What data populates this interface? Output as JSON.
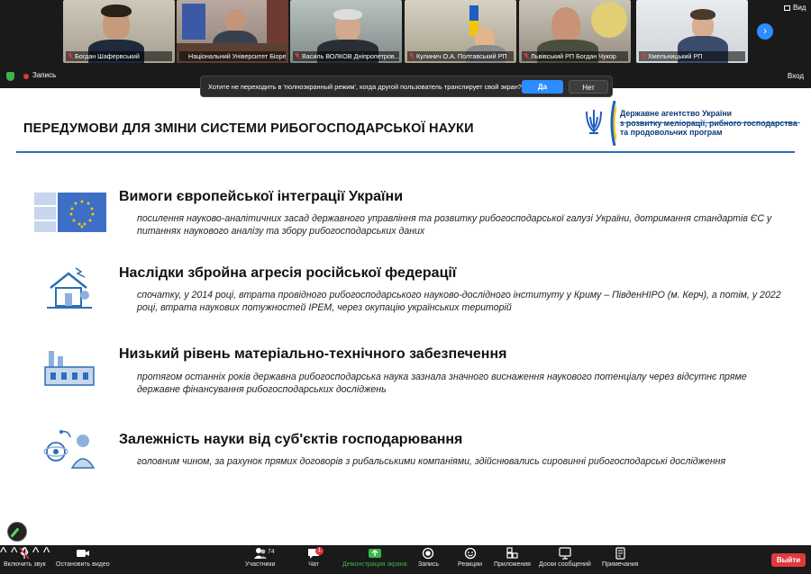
{
  "video_strip": {
    "participants": [
      {
        "name": "Богдан Шафервський",
        "muted": true
      },
      {
        "name": "Національний Університет Біоресу...",
        "muted": false
      },
      {
        "name": "Василь ВОЛКОВ Дніпропетров...",
        "muted": true
      },
      {
        "name": "Кулинич О.А. Полтавський РП",
        "muted": true
      },
      {
        "name": "Львівський РП Богдан Чукор",
        "muted": true
      },
      {
        "name": "Хмельницький РП",
        "muted": true
      }
    ],
    "view_label": "Вид",
    "next_arrow": "›"
  },
  "recording": {
    "label": "Запись",
    "exit_fullscreen": "Вход"
  },
  "fullscreen_prompt": {
    "message": "Хотите не переходить в 'полноэкранный режим', когда другой пользователь транслирует свой экран?",
    "yes": "Да",
    "no": "Нет"
  },
  "slide": {
    "title": "ПЕРЕДУМОВИ ДЛЯ ЗМІНИ СИСТЕМИ РИБОГОСПОДАРСЬКОЇ НАУКИ",
    "agency": {
      "line1": "Державне агентство України",
      "line2": "з розвитку меліорації, рибного господарства",
      "line3": "та продовольчих програм"
    },
    "items": [
      {
        "heading": "Вимоги європейської інтеграції України",
        "text": "посилення науково-аналітичних засад державного управління та розвитку рибогосподарської галузі України, дотримання стандартів ЄС у питаннях наукового аналізу та збору рибогосподарських даних",
        "icon": "eu-flag-icon"
      },
      {
        "heading": "Наслідки збройна агресія російської федерації",
        "text": "спочатку, у 2014 році, втрата провідного рибогосподарського науково-дослідного інституту у Криму – ПівденНІРО (м. Керч), а потім, у 2022 році, втрата наукових потужностей ІРЕМ, через окупацію українських територій",
        "icon": "destroyed-house-icon"
      },
      {
        "heading": "Низький рівень матеріально-технічного забезпечення",
        "text": "протягом останніх років державна рибогосподарська наука зазнала значного виснаження наукового потенціалу через відсутнє пряме державне фінансування рибогосподарських досліджень",
        "icon": "factory-icon"
      },
      {
        "heading": "Залежність науки від суб'єктів господарювання",
        "text": "головним чином, за рахунок прямих договорів з рибальськими компаніями, здійснювались сировинні рибогосподарські дослідження",
        "icon": "science-network-icon"
      }
    ]
  },
  "toolbar": {
    "unmute": "Включить звук",
    "stop_video": "Остановить видео",
    "participants": "Участники",
    "participants_count": "74",
    "chat": "Чат",
    "chat_badge": "1",
    "share_screen": "Демонстрация экрана",
    "record": "Запись",
    "reactions": "Реакции",
    "apps": "Приложения",
    "whiteboards": "Доски сообщений",
    "notes": "Примечания",
    "leave": "Выйти"
  },
  "colors": {
    "accent_blue": "#2d8cff",
    "leave_red": "#e0393e",
    "share_green": "#3ab54a",
    "slide_line": "#2c6fb7",
    "agency_navy": "#0b3a78"
  }
}
